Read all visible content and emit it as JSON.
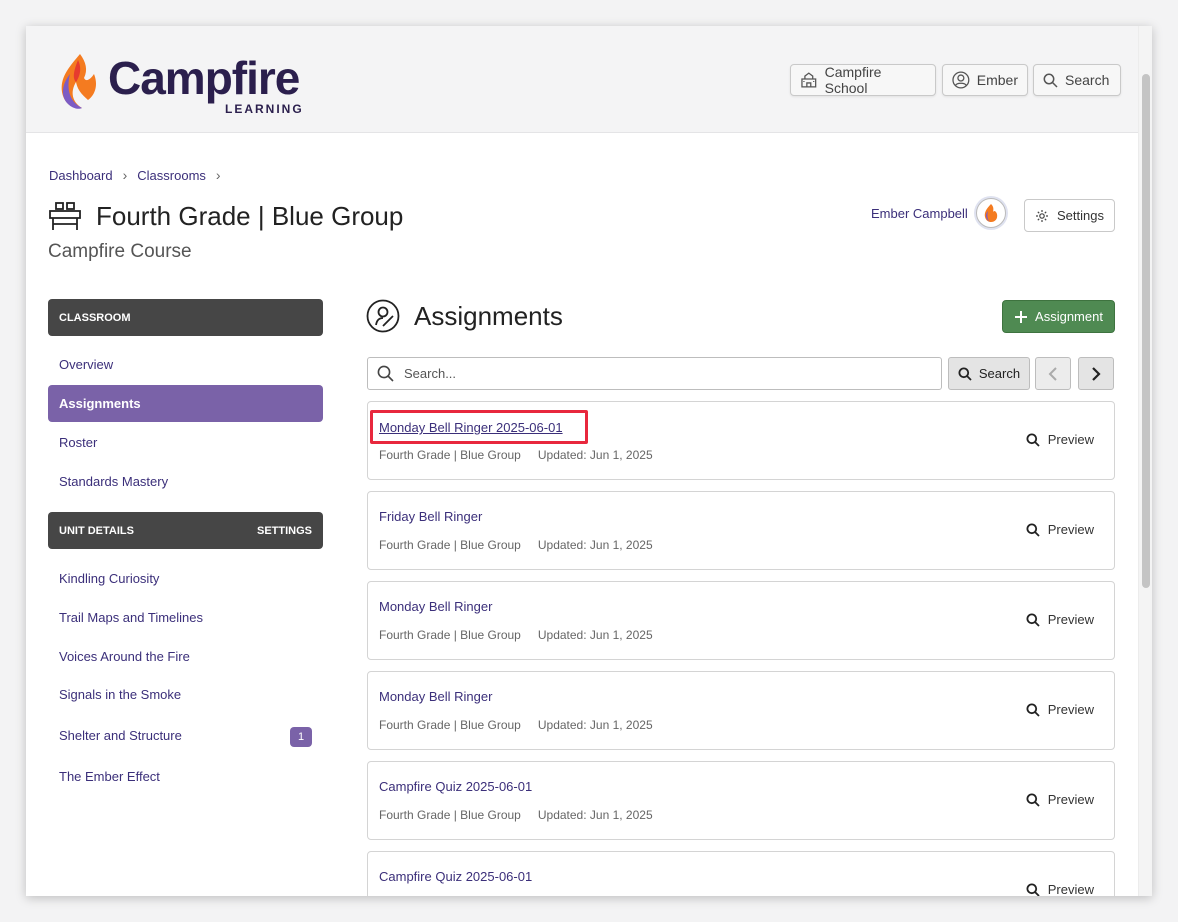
{
  "header": {
    "logo_word": "Campfire",
    "logo_sub": "LEARNING",
    "school_label": "Campfire School",
    "user_label": "Ember",
    "search_label": "Search"
  },
  "breadcrumbs": [
    "Dashboard",
    "Classrooms"
  ],
  "page": {
    "title": "Fourth Grade | Blue Group",
    "subtitle": "Campfire Course",
    "teacher_name": "Ember Campbell",
    "settings_label": "Settings"
  },
  "sidebar": {
    "classroom_header": "CLASSROOM",
    "classroom_items": [
      {
        "label": "Overview"
      },
      {
        "label": "Assignments",
        "active": true
      },
      {
        "label": "Roster"
      },
      {
        "label": "Standards Mastery"
      }
    ],
    "unit_header": "UNIT DETAILS",
    "unit_settings": "SETTINGS",
    "unit_items": [
      {
        "label": "Kindling Curiosity"
      },
      {
        "label": "Trail Maps and Timelines"
      },
      {
        "label": "Voices Around the Fire"
      },
      {
        "label": "Signals in the Smoke"
      },
      {
        "label": "Shelter and Structure",
        "badge": "1"
      },
      {
        "label": "The Ember Effect"
      }
    ]
  },
  "assignments": {
    "title": "Assignments",
    "add_label": "Assignment",
    "search_placeholder": "Search...",
    "search_button": "Search",
    "preview_label": "Preview",
    "items": [
      {
        "title": "Monday Bell Ringer 2025-06-01",
        "group": "Fourth Grade | Blue Group",
        "updated": "Updated: Jun 1, 2025",
        "highlighted": true
      },
      {
        "title": "Friday Bell Ringer",
        "group": "Fourth Grade | Blue Group",
        "updated": "Updated: Jun 1, 2025"
      },
      {
        "title": "Monday Bell Ringer",
        "group": "Fourth Grade | Blue Group",
        "updated": "Updated: Jun 1, 2025"
      },
      {
        "title": "Monday Bell Ringer",
        "group": "Fourth Grade | Blue Group",
        "updated": "Updated: Jun 1, 2025"
      },
      {
        "title": "Campfire Quiz 2025-06-01",
        "group": "Fourth Grade | Blue Group",
        "updated": "Updated: Jun 1, 2025"
      },
      {
        "title": "Campfire Quiz 2025-06-01"
      }
    ]
  },
  "colors": {
    "brand_purple": "#3b2f7a",
    "active_purple": "#7a62a8",
    "add_green": "#4f8a52",
    "highlight_red": "#e8283d"
  }
}
